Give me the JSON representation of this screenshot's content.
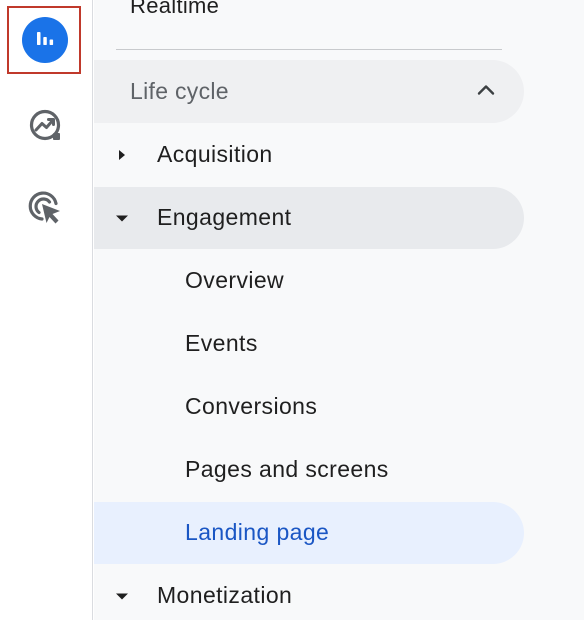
{
  "rail": {
    "items": [
      {
        "name": "reports",
        "icon": "bar-chart-icon",
        "selected": true
      },
      {
        "name": "explore",
        "icon": "explore-trend-icon",
        "selected": false
      },
      {
        "name": "advertising",
        "icon": "advertising-cursor-icon",
        "selected": false
      }
    ],
    "accent_color": "#1a73e8",
    "highlight_color": "#c0392b"
  },
  "nav": {
    "partial_item": "Realtime",
    "section": {
      "title": "Life cycle",
      "expanded": true,
      "toggle_icon": "chevron-up-icon"
    },
    "items": [
      {
        "label": "Acquisition",
        "expanded": false,
        "caret_icon": "caret-right-icon"
      },
      {
        "label": "Engagement",
        "expanded": true,
        "caret_icon": "caret-down-icon"
      },
      {
        "label": "Monetization",
        "expanded": true,
        "caret_icon": "caret-down-icon"
      }
    ],
    "engagement_children": [
      {
        "label": "Overview",
        "active": false
      },
      {
        "label": "Events",
        "active": false
      },
      {
        "label": "Conversions",
        "active": false
      },
      {
        "label": "Pages and screens",
        "active": false
      },
      {
        "label": "Landing page",
        "active": true
      }
    ],
    "active_text_color": "#1a56c4",
    "active_bg_color": "#e8f0fe"
  }
}
